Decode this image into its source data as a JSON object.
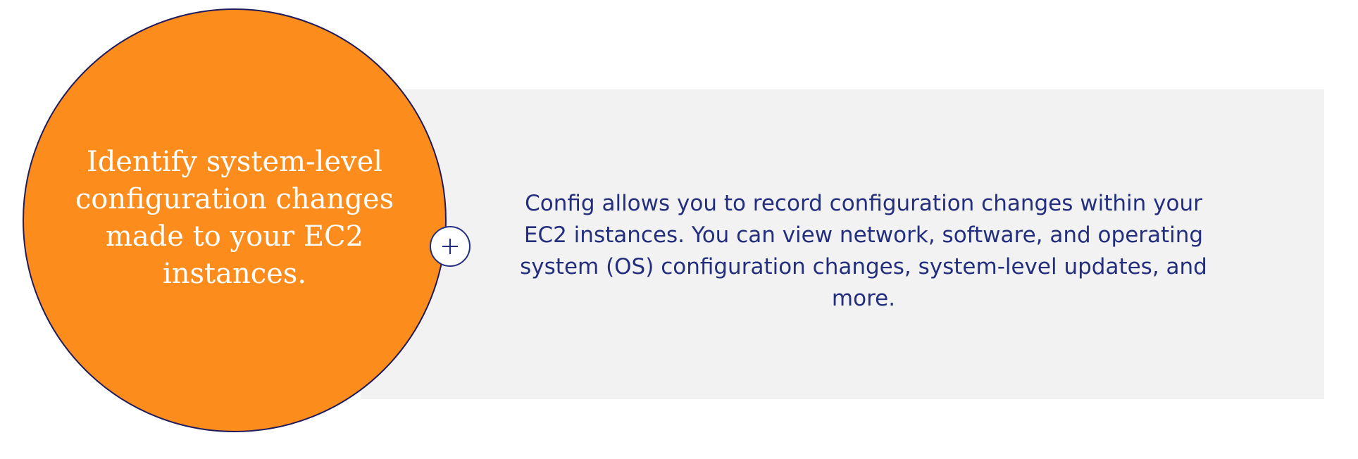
{
  "card": {
    "heading": "Identify system-level configuration changes made to your EC2 instances.",
    "description": "Config allows you to record configuration changes within your EC2 instances. You can view network, software, and operating system (OS) configuration changes, system-level updates, and more.",
    "toggle_icon": "plus-icon"
  },
  "colors": {
    "circle_fill": "#fc8c1c",
    "circle_border": "#1f1b5c",
    "panel_background": "#f2f2f2",
    "text_primary": "#232f7e",
    "circle_text": "#ffffff"
  }
}
